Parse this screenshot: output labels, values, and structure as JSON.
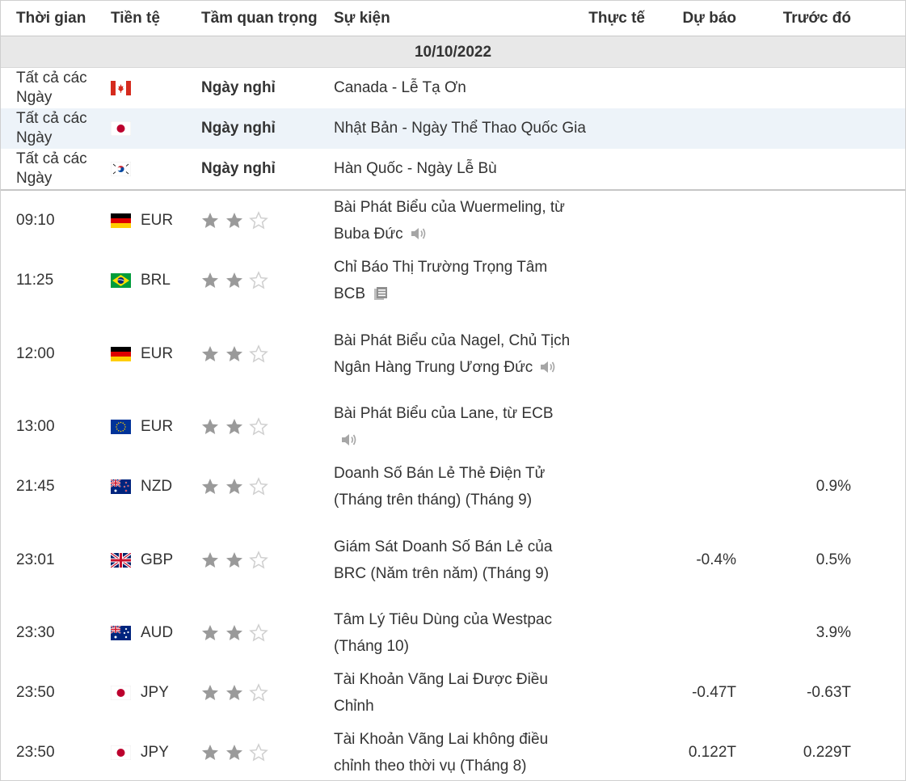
{
  "header": {
    "time": "Thời gian",
    "currency": "Tiền tệ",
    "importance": "Tầm quan trọng",
    "event": "Sự kiện",
    "actual": "Thực tế",
    "forecast": "Dự báo",
    "previous": "Trước đó"
  },
  "date": "10/10/2022",
  "holidays": [
    {
      "time": "Tất cả các Ngày",
      "flag": "canada-flag",
      "label": "Ngày nghỉ",
      "event": "Canada - Lễ Tạ Ơn"
    },
    {
      "time": "Tất cả các Ngày",
      "flag": "japan-flag",
      "label": "Ngày nghỉ",
      "event": "Nhật Bản - Ngày Thể Thao Quốc Gia"
    },
    {
      "time": "Tất cả các Ngày",
      "flag": "south-korea-flag",
      "label": "Ngày nghỉ",
      "event": "Hàn Quốc - Ngày Lễ Bù"
    }
  ],
  "events": [
    {
      "time": "09:10",
      "flag": "germany-flag",
      "currency": "EUR",
      "importance": 2,
      "event": "Bài Phát Biểu của Wuermeling, từ Buba Đức",
      "icon": "speaker-icon",
      "actual": "",
      "forecast": "",
      "previous": ""
    },
    {
      "time": "11:25",
      "flag": "brazil-flag",
      "currency": "BRL",
      "importance": 2,
      "event": "Chỉ Báo Thị Trường Trọng Tâm BCB",
      "icon": "report-icon",
      "actual": "",
      "forecast": "",
      "previous": ""
    },
    {
      "time": "12:00",
      "flag": "germany-flag",
      "currency": "EUR",
      "importance": 2,
      "event": "Bài Phát Biểu của Nagel, Chủ Tịch Ngân Hàng Trung Ương Đức",
      "icon": "speaker-icon",
      "actual": "",
      "forecast": "",
      "previous": ""
    },
    {
      "time": "13:00",
      "flag": "eu-flag",
      "currency": "EUR",
      "importance": 2,
      "event": "Bài Phát Biểu của Lane, từ ECB",
      "icon": "speaker-icon",
      "actual": "",
      "forecast": "",
      "previous": ""
    },
    {
      "time": "21:45",
      "flag": "new-zealand-flag",
      "currency": "NZD",
      "importance": 2,
      "event": "Doanh Số Bán Lẻ Thẻ Điện Tử (Tháng trên tháng) (Tháng 9)",
      "icon": "",
      "actual": "",
      "forecast": "",
      "previous": "0.9%"
    },
    {
      "time": "23:01",
      "flag": "uk-flag",
      "currency": "GBP",
      "importance": 2,
      "event": "Giám Sát Doanh Số Bán Lẻ của BRC (Năm trên năm) (Tháng 9)",
      "icon": "",
      "actual": "",
      "forecast": "-0.4%",
      "previous": "0.5%"
    },
    {
      "time": "23:30",
      "flag": "australia-flag",
      "currency": "AUD",
      "importance": 2,
      "event": "Tâm Lý Tiêu Dùng của Westpac (Tháng 10)",
      "icon": "",
      "actual": "",
      "forecast": "",
      "previous": "3.9%"
    },
    {
      "time": "23:50",
      "flag": "japan-flag",
      "currency": "JPY",
      "importance": 2,
      "event": "Tài Khoản Vãng Lai Được Điều Chỉnh",
      "icon": "",
      "actual": "",
      "forecast": "-0.47T",
      "previous": "-0.63T"
    },
    {
      "time": "23:50",
      "flag": "japan-flag",
      "currency": "JPY",
      "importance": 2,
      "event": "Tài Khoản Vãng Lai không điều chỉnh theo thời vụ (Tháng 8)",
      "icon": "",
      "actual": "",
      "forecast": "0.122T",
      "previous": "0.229T"
    }
  ],
  "colors": {
    "star_filled": "#9a9a9a",
    "star_empty": "#cfcfcf",
    "highlight_row": "#edf3f9",
    "date_bar": "#e8e8e8"
  }
}
